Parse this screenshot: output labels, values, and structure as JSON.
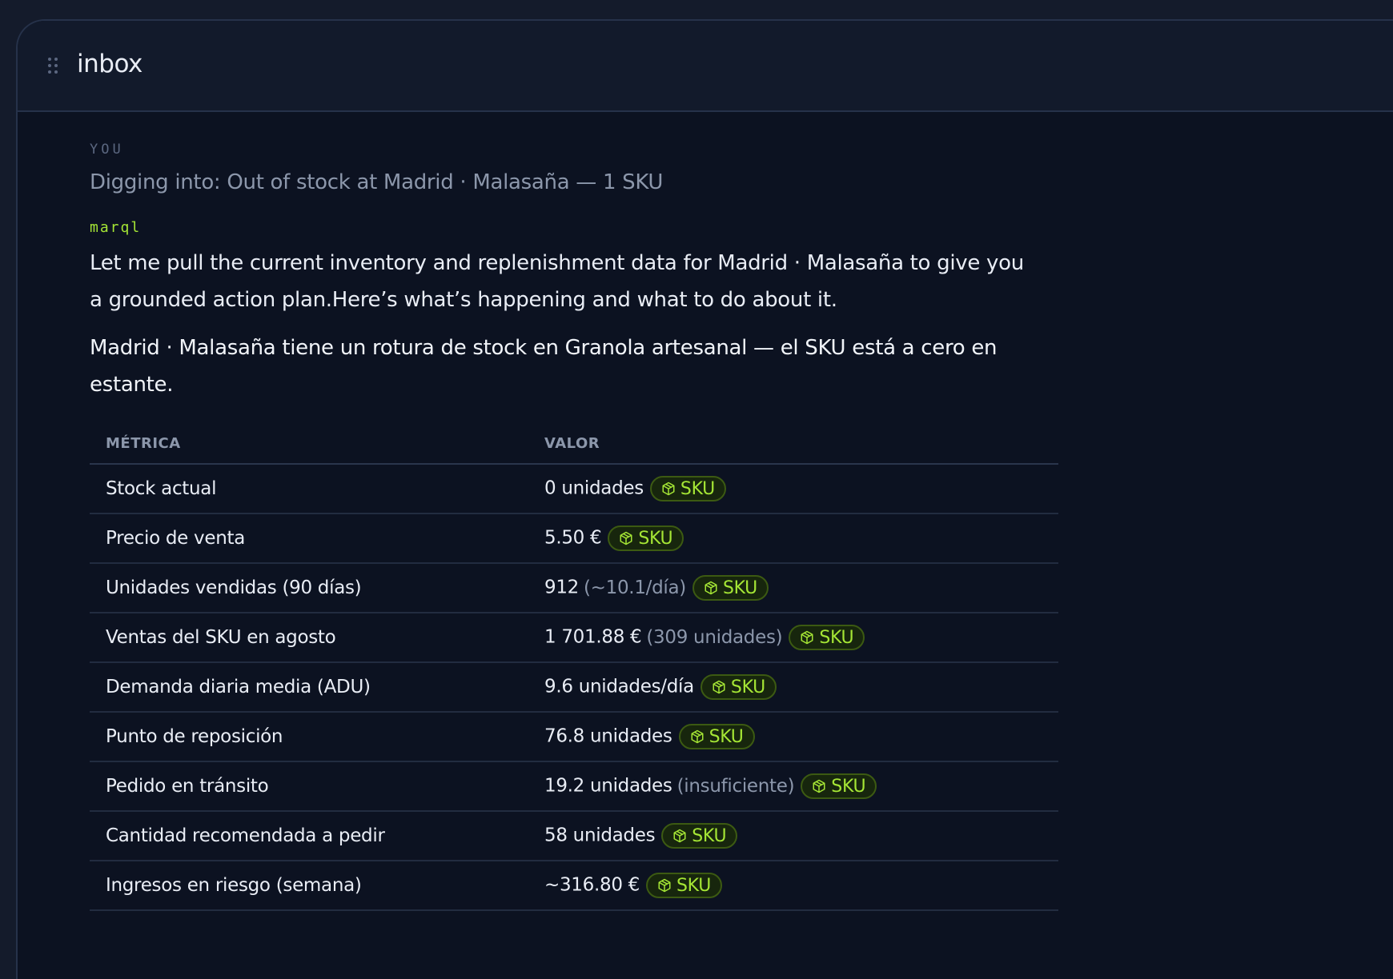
{
  "header": {
    "title": "inbox",
    "drag_icon": "drag-handle-icon"
  },
  "conversation": {
    "user_label": "YOU",
    "user_message": "Digging into: Out of stock at Madrid · Malasaña — 1 SKU",
    "agent_label": "marql",
    "agent_message": "Let me pull the current inventory and replenishment data for Madrid · Malasaña to give you a grounded action plan.Here’s what’s happening and what to do about it.",
    "agent_summary": "Madrid · Malasaña tiene un rotura de stock en Granola artesanal — el SKU está a cero en estante."
  },
  "table": {
    "headers": [
      "MÉTRICA",
      "VALOR"
    ],
    "badge_label": "SKU",
    "badge_icon": "package-icon",
    "rows": [
      {
        "metric": "Stock actual",
        "value": "0 unidades",
        "note": ""
      },
      {
        "metric": "Precio de venta",
        "value": "5.50 €",
        "note": ""
      },
      {
        "metric": "Unidades vendidas (90 días)",
        "value": "912",
        "note": "(~10.1/día)"
      },
      {
        "metric": "Ventas del SKU en agosto",
        "value": "1 701.88 €",
        "note": "(309 unidades)"
      },
      {
        "metric": "Demanda diaria media (ADU)",
        "value": "9.6 unidades/día",
        "note": ""
      },
      {
        "metric": "Punto de reposición",
        "value": "76.8 unidades",
        "note": ""
      },
      {
        "metric": "Pedido en tránsito",
        "value": "19.2 unidades",
        "note": "(insuficiente)"
      },
      {
        "metric": "Cantidad recomendada a pedir",
        "value": "58 unidades",
        "note": ""
      },
      {
        "metric": "Ingresos en riesgo (semana)",
        "value": "~316.80 €",
        "note": ""
      }
    ]
  },
  "colors": {
    "accent": "#a5e635",
    "background": "#0c1221",
    "header_background": "#121a2b",
    "text_primary": "#e9edf5",
    "text_muted": "#8c97ab"
  }
}
